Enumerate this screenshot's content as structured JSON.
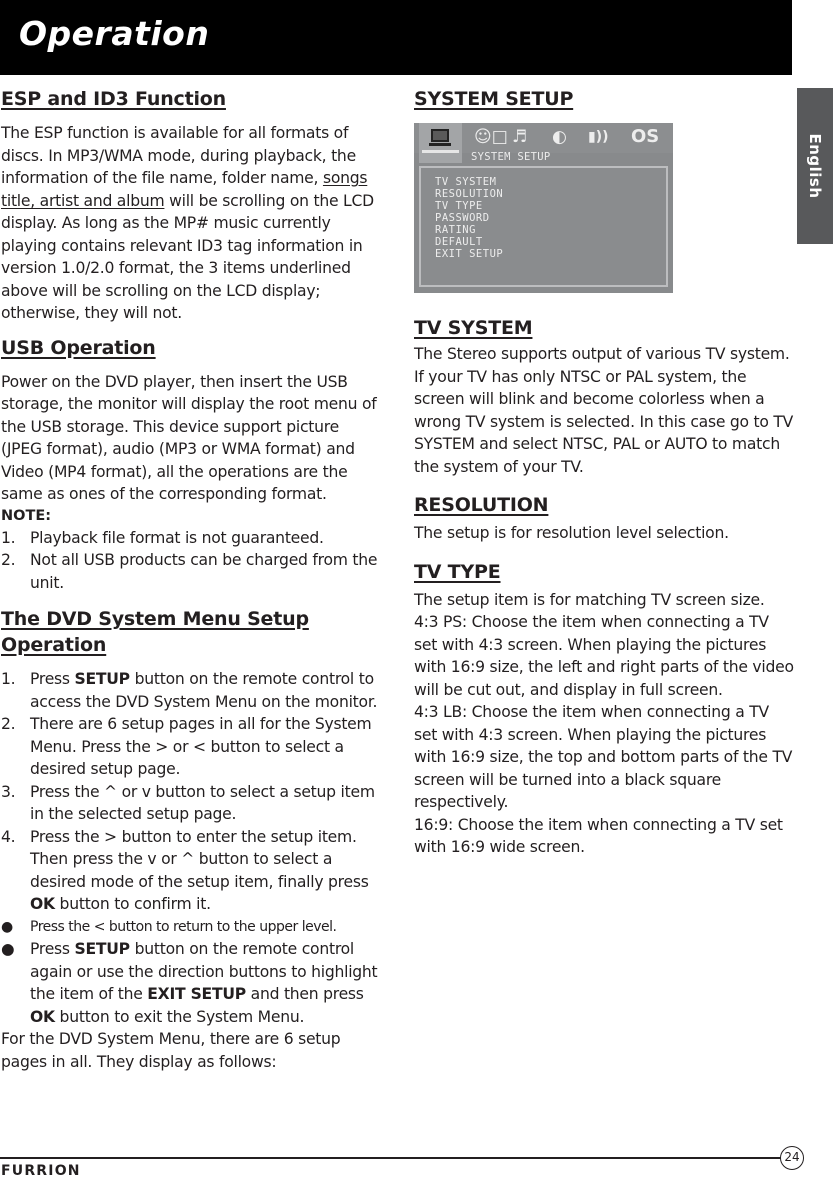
{
  "header": {
    "title": "Operation"
  },
  "language_tab": {
    "label": "English"
  },
  "left_column": {
    "esp": {
      "heading": "ESP and ID3 Function",
      "para_before": "The ESP function is available for all formats of discs. In MP3/WMA mode, during playback, the information of the file name, folder name, ",
      "para_underlined": "songs title, artist and album",
      "para_after": " will be scrolling on the LCD display. As long as the MP# music currently playing contains relevant ID3 tag information in version 1.0/2.0 format, the 3 items underlined above will be scrolling on the LCD display; otherwise, they will not."
    },
    "usb": {
      "heading": "USB Operation",
      "paragraph": "Power on the DVD player, then insert the USB storage, the monitor will display the root menu of the USB storage. This device support picture (JPEG format), audio (MP3 or WMA format) and Video (MP4 format), all the operations are the same as ones of the corresponding format.",
      "note_label": "NOTE:",
      "notes": [
        {
          "num": "1.",
          "text": "Playback file format is not guaranteed."
        },
        {
          "num": "2.",
          "text": "Not all USB products can be charged from the unit."
        }
      ]
    },
    "dvd_menu": {
      "heading": "The DVD System Menu Setup Operation",
      "steps": [
        {
          "num": "1.",
          "pre": "Press ",
          "bold": "SETUP",
          "post": " button on the remote control to access the DVD System Menu on the monitor."
        },
        {
          "num": "2.",
          "text": "There are 6 setup pages in all for the System Menu. Press the > or < button to select a desired setup page."
        },
        {
          "num": "3.",
          "text": "Press the ^ or v button to select a setup item in the selected setup page."
        },
        {
          "num": "4.",
          "pre": "Press the > button to enter the setup item. Then press the v or ^ button to select a desired mode of the setup item, finally press ",
          "bold": "OK",
          "post": " button to confirm it."
        }
      ],
      "bullets": [
        {
          "symbol": "●",
          "text": "Press the < button to return to the upper level."
        },
        {
          "symbol": "●",
          "pre": "Press ",
          "bold1": "SETUP",
          "mid1": " button on the remote control again or use the direction buttons to highlight the item of the ",
          "bold2": "EXIT SETUP",
          "mid2": " and then press ",
          "bold3": "OK",
          "post": " button to exit the System Menu."
        }
      ],
      "closing": "For the DVD System Menu, there are 6 setup pages in all. They display as follows:"
    }
  },
  "right_column": {
    "system_setup": {
      "heading": "SYSTEM SETUP",
      "osd": {
        "tab_icons": [
          "monitor-icon",
          "person-screen-icon",
          "music-note-icon",
          "circle-icon",
          "speaker-icon",
          "os-icon"
        ],
        "os_label": "OS",
        "subtitle": "SYSTEM SETUP",
        "items": [
          "TV SYSTEM",
          "RESOLUTION",
          "TV TYPE",
          "PASSWORD",
          "RATING",
          "DEFAULT",
          "EXIT SETUP"
        ]
      }
    },
    "tv_system": {
      "heading": "TV SYSTEM",
      "paragraph": "The Stereo supports output of various TV system. If your TV has only NTSC or PAL system, the screen will blink and become colorless when a wrong TV system is selected. In this case go to TV SYSTEM and select NTSC, PAL or AUTO to match the system of your TV."
    },
    "resolution": {
      "heading": "RESOLUTION",
      "paragraph": "The setup is for resolution level selection."
    },
    "tv_type": {
      "heading": "TV TYPE",
      "intro": "The setup item is for matching TV screen size.",
      "ps": "4:3 PS: Choose the item when connecting a TV set with 4:3 screen. When playing the pictures with 16:9 size, the left and right parts of the video will be cut out, and display in full screen.",
      "lb": "4:3 LB: Choose the item when connecting a TV set with 4:3 screen. When playing the pictures with 16:9 size, the top and bottom parts of the TV screen will be turned into a black square respectively.",
      "wide": "16:9: Choose the item when connecting a TV set with 16:9 wide screen."
    }
  },
  "footer": {
    "brand": "FURRION",
    "page_number": "24"
  }
}
